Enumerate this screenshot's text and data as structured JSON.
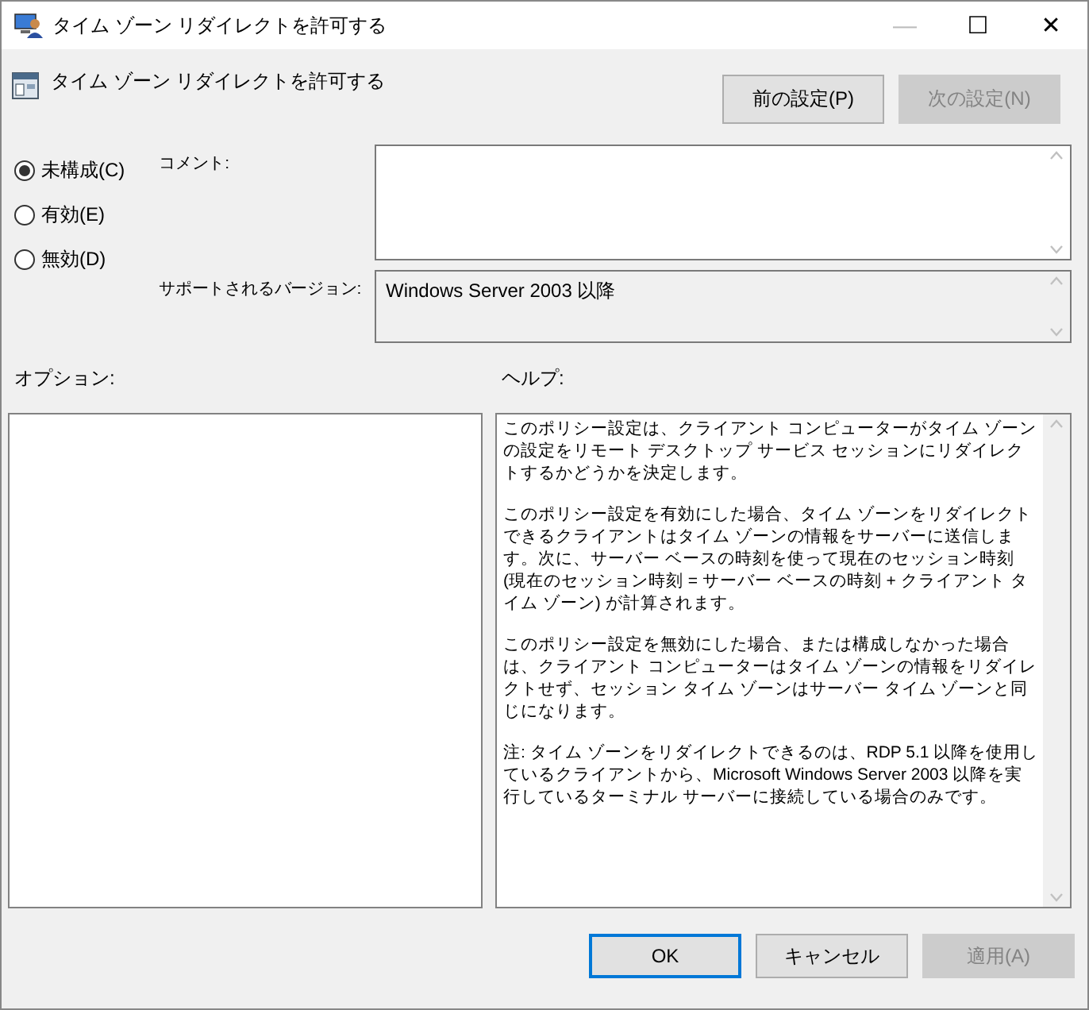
{
  "window": {
    "title": "タイム ゾーン リダイレクトを許可する",
    "controls": [
      "—",
      "☐",
      "✕"
    ]
  },
  "header": {
    "title": "タイム ゾーン リダイレクトを許可する"
  },
  "nav_buttons": [
    {
      "label": "前の設定(P)",
      "disabled": false
    },
    {
      "label": "次の設定(N)",
      "disabled": true
    }
  ],
  "state_options": [
    {
      "label": "未構成(C)",
      "selected": true
    },
    {
      "label": "有効(E)",
      "selected": false
    },
    {
      "label": "無効(D)",
      "selected": false
    }
  ],
  "comment": {
    "label": "コメント:"
  },
  "supported": {
    "label": "サポートされるバージョン:",
    "value": "Windows Server 2003 以降"
  },
  "options": {
    "label": "オプション:"
  },
  "help": {
    "label": "ヘルプ:",
    "paragraphs": [
      "このポリシー設定は、クライアント コンピューターがタイム ゾーンの設定をリモート デスクトップ サービス セッションにリダイレクトするかどうかを決定します。",
      "このポリシー設定を有効にした場合、タイム ゾーンをリダイレクトできるクライアントはタイム ゾーンの情報をサーバーに送信します。次に、サーバー ベースの時刻を使って現在のセッション時刻 (現在のセッション時刻 = サーバー ベースの時刻 + クライアント タイム ゾーン) が計算されます。",
      "このポリシー設定を無効にした場合、または構成しなかった場合は、クライアント コンピューターはタイム ゾーンの情報をリダイレクトせず、セッション タイム ゾーンはサーバー タイム ゾーンと同じになります。",
      "注: タイム ゾーンをリダイレクトできるのは、RDP 5.1 以降を使用しているクライアントから、Microsoft Windows Server 2003 以降を実行しているターミナル サーバーに接続している場合のみです。"
    ]
  },
  "footer_buttons": [
    {
      "label": "OK",
      "focused": true,
      "disabled": false
    },
    {
      "label": "キャンセル",
      "focused": false,
      "disabled": false
    },
    {
      "label": "適用(A)",
      "focused": false,
      "disabled": true
    }
  ]
}
